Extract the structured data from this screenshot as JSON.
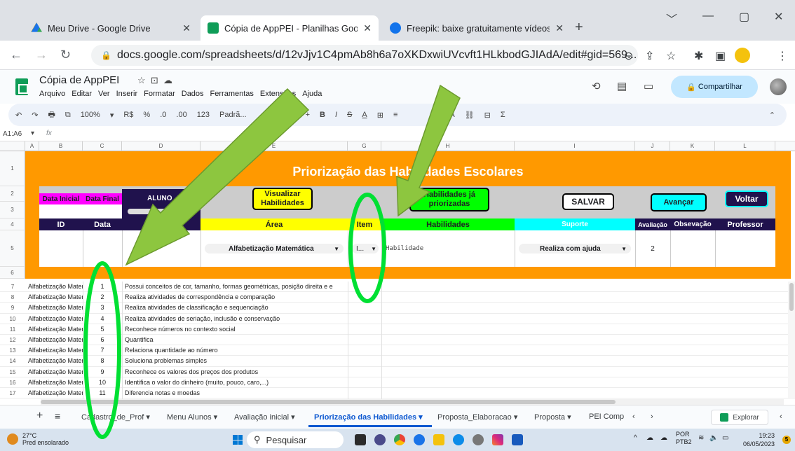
{
  "browser": {
    "tabs": [
      {
        "title": "Meu Drive - Google Drive",
        "icon": "google-drive-icon",
        "color": "#1a73e8"
      },
      {
        "title": "Cópia de AppPEI - Planilhas Google",
        "icon": "google-sheets-icon",
        "color": "#0f9d58"
      },
      {
        "title": "Freepik: baixe gratuitamente vídeos",
        "icon": "freepik-icon",
        "color": "#1273eb"
      }
    ],
    "close_glyph": "✕",
    "new_tab": "+",
    "url": "docs.google.com/spreadsheets/d/12vJjv1C4pmAb8h6a7oXKDxwiUVcvft1HLkbodGJIAdA/edit#gid=569...",
    "window_controls": [
      "﹀",
      "—",
      "▢",
      "✕"
    ]
  },
  "sheets": {
    "title": "Cópia de AppPEI",
    "menu": [
      "Arquivo",
      "Editar",
      "Ver",
      "Inserir",
      "Formatar",
      "Dados",
      "Ferramentas",
      "Extensões",
      "Ajuda"
    ],
    "share_label": "Compartilhar",
    "toolbar": [
      "↶",
      "↷",
      "🖶",
      "⧉",
      "100%",
      "▾",
      "R$",
      "%",
      ".0",
      ".00",
      "123",
      "Padrã...",
      "+",
      "B",
      "I",
      "S",
      "A",
      "⊞",
      "≡",
      "A",
      "⛓",
      "⊟",
      "Σ"
    ],
    "name_box": "A1:A6",
    "fx": "fx",
    "columns": [
      "A",
      "B",
      "C",
      "D",
      "E",
      "G",
      "H",
      "I",
      "J",
      "K",
      "L"
    ]
  },
  "form": {
    "title": "Priorização das Habilidades Escolares",
    "data_inicial": "Data Inicial",
    "data_final": "Data Final",
    "aluno": "ALUNO",
    "btn_visualizar": "Visualizar Habilidades",
    "btn_priorizadas": "Habilidades já priorizadas",
    "btn_salvar": "SALVAR",
    "btn_avancar": "Avançar",
    "btn_voltar": "Voltar",
    "headers": {
      "id": "ID",
      "data": "Data",
      "area": "Área",
      "item": "Item",
      "habilidades": "Habilidades",
      "suporte": "Suporte",
      "avaliacao": "Avaliação",
      "observacao": "Obsevação",
      "professor": "Professor"
    },
    "row": {
      "area": "Alfabetização Matemática",
      "item": "I...",
      "habilidade": "Habilidade",
      "suporte": "Realiza com ajuda",
      "avaliacao": "2"
    }
  },
  "list": [
    {
      "row": "7",
      "area": "Alfabetização Matem",
      "num": "1",
      "desc": "Possui conceitos de cor, tamanho, formas geométricas, posição direita e e"
    },
    {
      "row": "8",
      "area": "Alfabetização Matem",
      "num": "2",
      "desc": "Realiza atividades de correspondência e comparação"
    },
    {
      "row": "9",
      "area": "Alfabetização Matem",
      "num": "3",
      "desc": "Realiza atividades de classificação e sequenciação"
    },
    {
      "row": "10",
      "area": "Alfabetização Matem",
      "num": "4",
      "desc": "Realiza atividades de seriação, inclusão e conservação"
    },
    {
      "row": "11",
      "area": "Alfabetização Matem",
      "num": "5",
      "desc": "Reconhece números no contexto social"
    },
    {
      "row": "12",
      "area": "Alfabetização Matem",
      "num": "6",
      "desc": "Quantifica"
    },
    {
      "row": "13",
      "area": "Alfabetização Matem",
      "num": "7",
      "desc": "Relaciona quantidade ao número"
    },
    {
      "row": "14",
      "area": "Alfabetização Matem",
      "num": "8",
      "desc": "Soluciona problemas simples"
    },
    {
      "row": "15",
      "area": "Alfabetização Matem",
      "num": "9",
      "desc": "Reconhece os valores dos preços dos produtos"
    },
    {
      "row": "16",
      "area": "Alfabetização Matem",
      "num": "10",
      "desc": "Identifica o valor do dinheiro (muito, pouco, caro,...)"
    },
    {
      "row": "17",
      "area": "Alfabetização Matem",
      "num": "11",
      "desc": "Diferencia notas e moedas"
    }
  ],
  "sheet_tabs": [
    {
      "label": "Cadastro_de_Prof ▾"
    },
    {
      "label": "Menu Alunos ▾"
    },
    {
      "label": "Avaliação inicial ▾"
    },
    {
      "label": "Priorização das Habilidades ▾"
    },
    {
      "label": "Proposta_Elaboracao ▾"
    },
    {
      "label": "Proposta ▾"
    },
    {
      "label": "PEI Comp"
    }
  ],
  "explorar_label": "Explorar",
  "taskbar": {
    "temperature": "27°C",
    "weather": "Pred ensolarado",
    "search": "Pesquisar",
    "lang": "POR",
    "lang2": "PTB2",
    "time": "19:23",
    "date": "06/05/2023",
    "notif_count": "5"
  },
  "colors": {
    "orange": "#ff9900",
    "navy": "#20124d",
    "magenta": "#ff00ff",
    "yellow": "#ffff00",
    "green": "#00ff00",
    "cyan": "#00ffff",
    "arrow_green": "#8dc63f",
    "active_tab": "#0b57d0"
  }
}
